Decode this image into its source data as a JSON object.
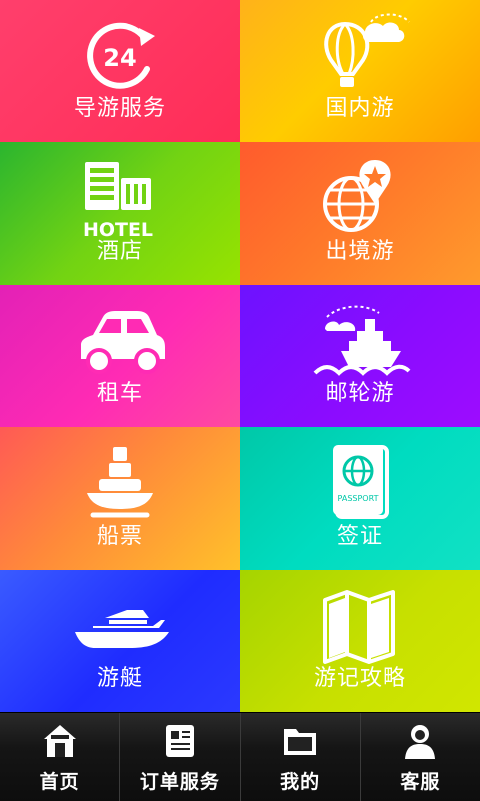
{
  "tiles": [
    {
      "id": "guide",
      "label": "导游服务",
      "icon": "24-hour-icon"
    },
    {
      "id": "domestic",
      "label": "国内游",
      "icon": "hot-air-balloon-icon"
    },
    {
      "id": "hotel",
      "label": "酒店",
      "icon": "hotel-building-icon",
      "icon_text": "HOTEL"
    },
    {
      "id": "outbound",
      "label": "出境游",
      "icon": "globe-pin-icon"
    },
    {
      "id": "car",
      "label": "租车",
      "icon": "car-icon"
    },
    {
      "id": "cruise",
      "label": "邮轮游",
      "icon": "cruise-ship-icon"
    },
    {
      "id": "ticket",
      "label": "船票",
      "icon": "ship-icon"
    },
    {
      "id": "visa",
      "label": "签证",
      "icon": "passport-icon",
      "icon_text": "PASSPORT"
    },
    {
      "id": "yacht",
      "label": "游艇",
      "icon": "yacht-icon"
    },
    {
      "id": "journal",
      "label": "游记攻略",
      "icon": "map-icon"
    }
  ],
  "icon_text": {
    "guide_number": "24"
  },
  "nav": [
    {
      "label": "首页",
      "icon": "home-icon"
    },
    {
      "label": "订单服务",
      "icon": "order-list-icon"
    },
    {
      "label": "我的",
      "icon": "folder-icon"
    },
    {
      "label": "客服",
      "icon": "customer-service-icon"
    }
  ],
  "colors": {
    "guide": "#ff2d57",
    "domestic": "#ffc400",
    "hotel": "#72d313",
    "outbound": "#ff7a2a",
    "car": "#ff2bb4",
    "cruise": "#8a0cff",
    "ticket": "#ffa33a",
    "visa": "#00dcc0",
    "yacht": "#1f2cff",
    "journal": "#c7e000",
    "nav_bg": "#151515"
  }
}
